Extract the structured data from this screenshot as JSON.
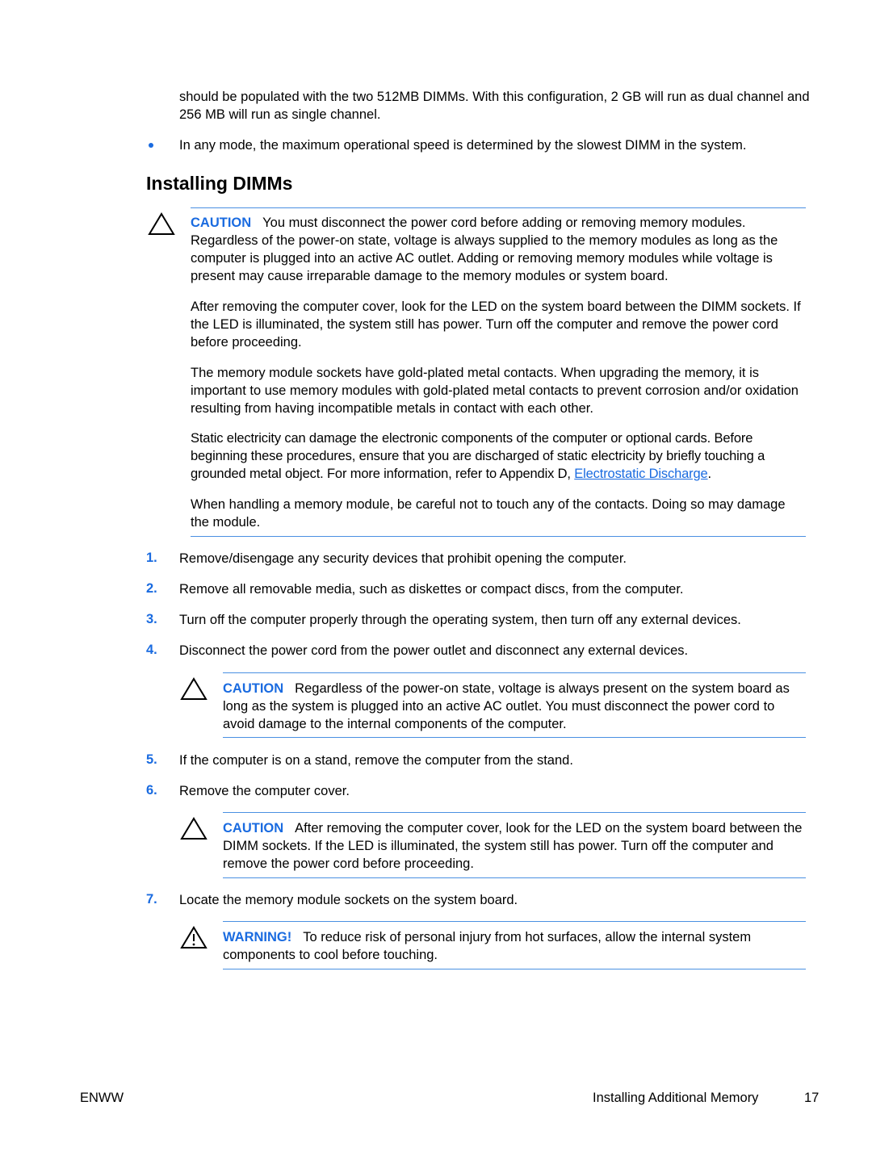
{
  "intro": {
    "continued_text": "should be populated with the two 512MB DIMMs. With this configuration, 2 GB will run as dual channel and 256 MB will run as single channel.",
    "bullet_text": "In any mode, the maximum operational speed is determined by the slowest DIMM in the system."
  },
  "section": {
    "title": "Installing DIMMs"
  },
  "caution_main": {
    "icon": "caution-triangle-icon",
    "label": "CAUTION",
    "text": "You must disconnect the power cord before adding or removing memory modules. Regardless of the power-on state, voltage is always supplied to the memory modules as long as the computer is plugged into an active AC outlet. Adding or removing memory modules while voltage is present may cause irreparable damage to the memory modules or system board.",
    "para2": "After removing the computer cover, look for the LED on the system board between the DIMM sockets. If the LED is illuminated, the system still has power. Turn off the computer and remove the power cord before proceeding.",
    "para3": "The memory module sockets have gold-plated metal contacts. When upgrading the memory, it is important to use memory modules with gold-plated metal contacts to prevent corrosion and/or oxidation resulting from having incompatible metals in contact with each other.",
    "para4_pre": "Static electricity can damage the electronic components of the computer or optional cards. Before beginning these procedures, ensure that you are discharged of static electricity by briefly touching a grounded metal object. For more information, refer to Appendix D, ",
    "para4_link": "Electrostatic Discharge",
    "para4_post": ".",
    "para5": "When handling a memory module, be careful not to touch any of the contacts. Doing so may damage the module."
  },
  "steps": [
    {
      "num": "1.",
      "text": "Remove/disengage any security devices that prohibit opening the computer."
    },
    {
      "num": "2.",
      "text": "Remove all removable media, such as diskettes or compact discs, from the computer."
    },
    {
      "num": "3.",
      "text": "Turn off the computer properly through the operating system, then turn off any external devices."
    },
    {
      "num": "4.",
      "text": "Disconnect the power cord from the power outlet and disconnect any external devices."
    },
    {
      "num": "5.",
      "text": "If the computer is on a stand, remove the computer from the stand."
    },
    {
      "num": "6.",
      "text": "Remove the computer cover."
    },
    {
      "num": "7.",
      "text": "Locate the memory module sockets on the system board."
    }
  ],
  "caution_step4": {
    "label": "CAUTION",
    "text": "Regardless of the power-on state, voltage is always present on the system board as long as the system is plugged into an active AC outlet. You must disconnect the power cord to avoid damage to the internal components of the computer."
  },
  "caution_step6": {
    "label": "CAUTION",
    "text": "After removing the computer cover, look for the LED on the system board between the DIMM sockets. If the LED is illuminated, the system still has power. Turn off the computer and remove the power cord before proceeding."
  },
  "warning_step7": {
    "label": "WARNING!",
    "text": "To reduce risk of personal injury from hot surfaces, allow the internal system components to cool before touching."
  },
  "footer": {
    "left": "ENWW",
    "chapter": "Installing Additional Memory",
    "page": "17"
  },
  "colors": {
    "accent": "#1a6be0",
    "rule": "#4a90e2"
  }
}
